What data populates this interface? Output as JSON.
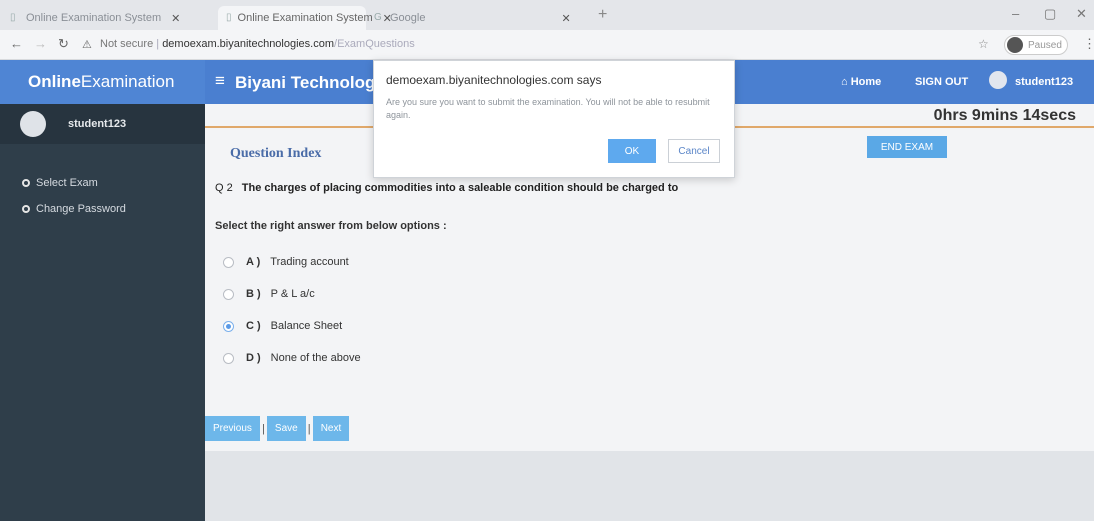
{
  "browser": {
    "tabs": [
      {
        "label": "Online Examination System",
        "favicon": "doc-icon"
      },
      {
        "label": "Online Examination System",
        "favicon": "doc-icon"
      },
      {
        "label": "Google",
        "favicon": "google-icon"
      }
    ],
    "url_security": "Not secure",
    "url_host": "demoexam.biyanitechnologies.com",
    "url_path": "/ExamQuestions",
    "profile_status": "Paused"
  },
  "app": {
    "brand_bold": "Online",
    "brand_rest": "Examination",
    "site_title": "Biyani Technologies",
    "nav": {
      "home": "Home",
      "signout": "SIGN OUT",
      "user": "student123"
    }
  },
  "sidebar": {
    "username": "student123",
    "items": [
      {
        "label": "Select Exam"
      },
      {
        "label": "Change Password"
      }
    ]
  },
  "exam": {
    "timer": "0hrs 9mins 14secs",
    "question_index_label": "Question Index",
    "end_exam_label": "END EXAM",
    "question_number": "Q 2",
    "question_text": "The charges of placing commodities into a saleable condition should be charged to",
    "select_hint": "Select the right answer from below options :",
    "options": [
      {
        "letter": "A )",
        "text": "Trading account",
        "checked": false
      },
      {
        "letter": "B )",
        "text": "P & L a/c",
        "checked": false
      },
      {
        "letter": "C )",
        "text": "Balance Sheet",
        "checked": true
      },
      {
        "letter": "D )",
        "text": "None of the above",
        "checked": false
      }
    ],
    "buttons": {
      "previous": "Previous",
      "save": "Save",
      "next": "Next",
      "separator": "|"
    }
  },
  "dialog": {
    "title": "demoexam.biyanitechnologies.com says",
    "message": "Are you sure you want to submit the examination. You will not be able to resubmit again.",
    "ok": "OK",
    "cancel": "Cancel"
  },
  "colors": {
    "header": "#4a7fd0",
    "sidebar": "#2f3e4a",
    "accent": "#5ea9ee",
    "timer_rule": "#e0a86a"
  }
}
